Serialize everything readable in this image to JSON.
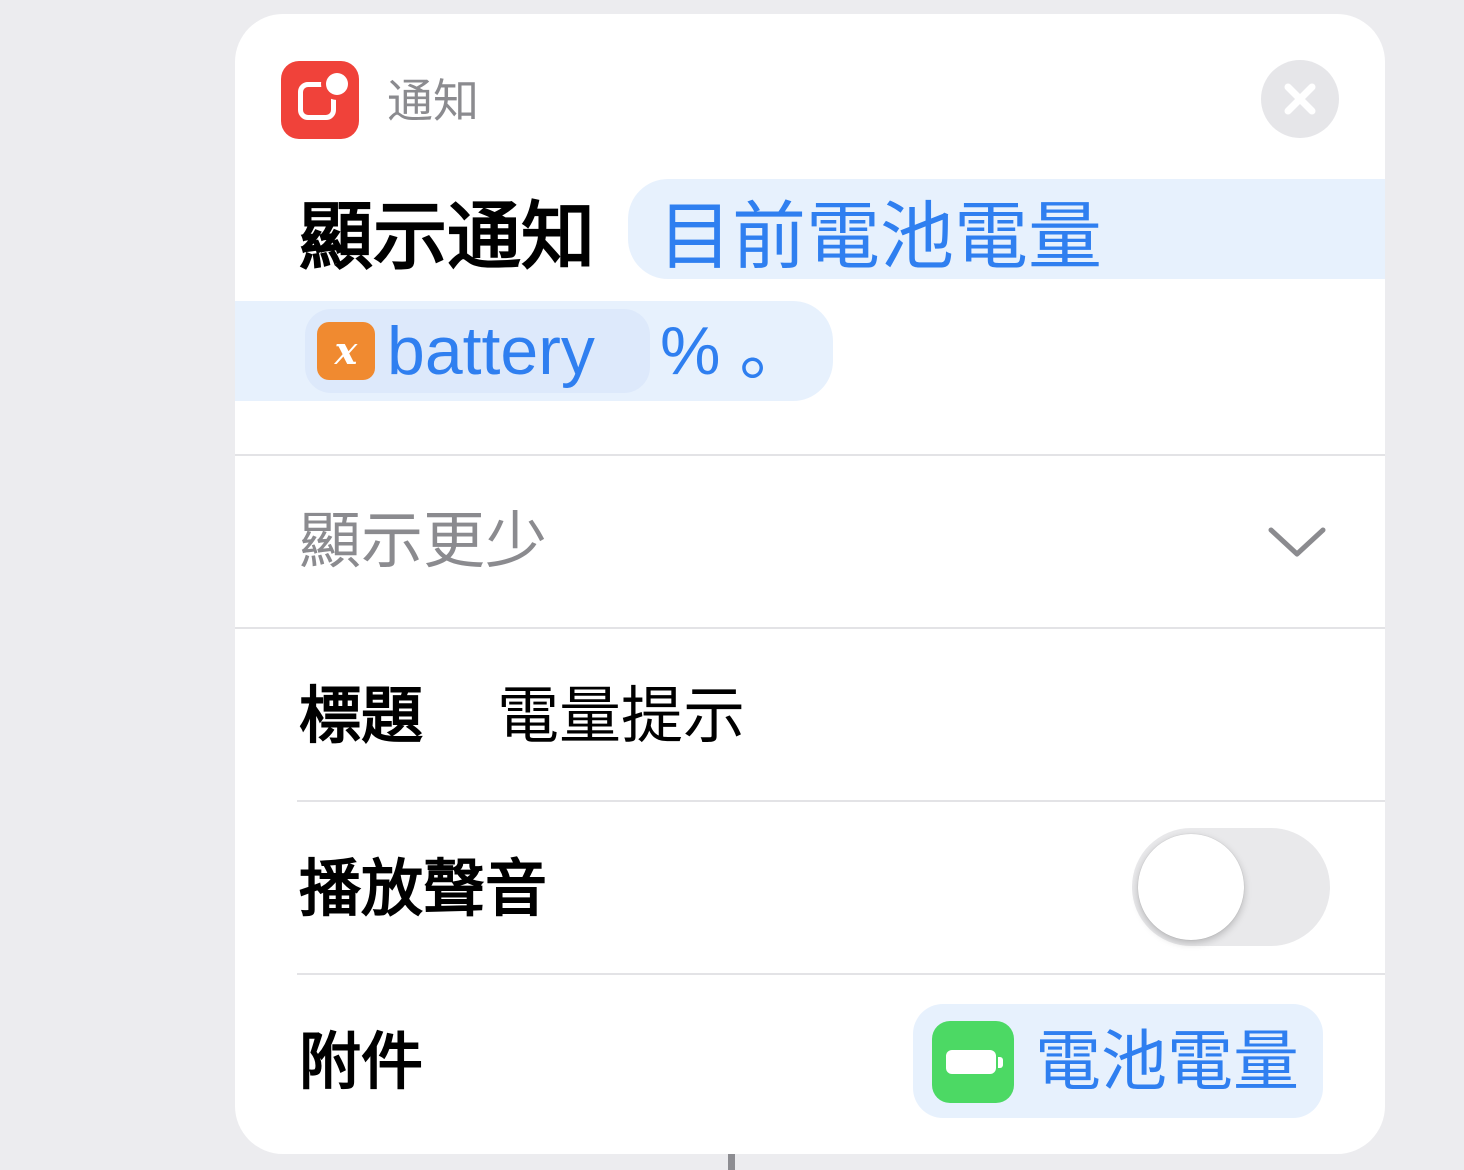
{
  "header": {
    "app_name": "通知",
    "app_icon": "notification-app-icon",
    "close_icon": "close-icon"
  },
  "action": {
    "label": "顯示通知",
    "text_param": "目前電池電量",
    "variable": {
      "icon": "variable-icon",
      "icon_glyph": "x",
      "name": "battery"
    },
    "suffix": "% 。"
  },
  "show_less": {
    "label": "顯示更少",
    "icon": "chevron-down-icon"
  },
  "options": {
    "title": {
      "label": "標題",
      "value": "電量提示"
    },
    "play_sound": {
      "label": "播放聲音",
      "on": false
    },
    "attachment": {
      "label": "附件",
      "icon": "battery-icon",
      "value": "電池電量"
    }
  },
  "colors": {
    "accent_blue": "#2f7ff0",
    "app_red": "#f0423a",
    "variable_orange": "#f08a30",
    "battery_green": "#4cd964"
  }
}
